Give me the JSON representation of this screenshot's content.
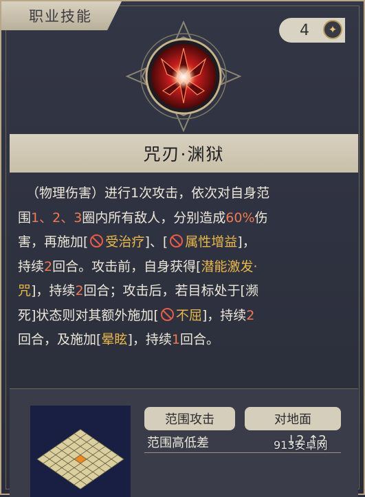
{
  "header": {
    "tab_label": "职业技能",
    "cost_value": "4",
    "cost_icon": "star-icon"
  },
  "skill": {
    "emblem_icon": "shattered-crystal-icon",
    "name": "咒刃·渊狱"
  },
  "description": {
    "l1": "（物理伤害）进行1次攻击，依次对自身范",
    "l2a": "围",
    "l2b": "1、2、3",
    "l2c": "圈内所有敌人，分别造成",
    "l2d": "60%",
    "l2e": "伤",
    "l3a": "害，再施加[",
    "l3b": "受治疗",
    "l3c": "]、[",
    "l3d": "属性增益",
    "l3e": "]，",
    "l4a": "持续",
    "l4b": "2",
    "l4c": "回合。攻击前，自身获得[",
    "l4d": "潜能激发·",
    "l5a": "咒",
    "l5b": "]，持续",
    "l5c": "2",
    "l5d": "回合；攻击后，若目标处于[濒",
    "l6a": "死]状态则对其额外施加[",
    "l6b": "不屈",
    "l6c": "]，持续",
    "l6d": "2",
    "l7a": "回合，及施加[",
    "l7b": "晕眩",
    "l7c": "]，持续",
    "l7d": "1",
    "l7e": "回合。"
  },
  "attributes": {
    "chip_range": "范围攻击",
    "chip_target": "对地面",
    "height_label": "范围高低差",
    "height_values": "↓2  ↑2"
  },
  "watermark": "913安卓网",
  "colors": {
    "highlight_red": "#f07a52",
    "highlight_gold": "#e9b84a",
    "panel_bg": "#2b2e3a",
    "band": "#d8d1bf"
  }
}
